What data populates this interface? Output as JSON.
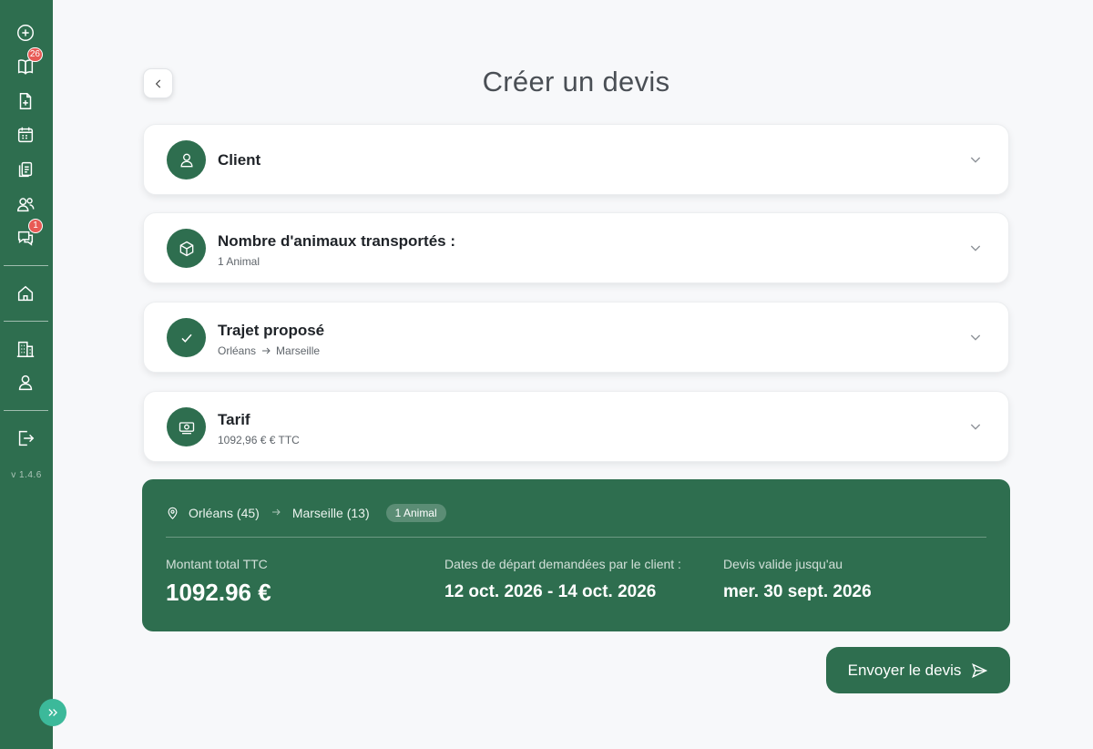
{
  "sidebar": {
    "icons": [
      {
        "name": "add-circle-icon"
      },
      {
        "name": "book-icon",
        "badge": "26"
      },
      {
        "name": "new-document-icon"
      },
      {
        "name": "calendar-icon"
      },
      {
        "name": "documents-icon"
      },
      {
        "name": "users-icon"
      },
      {
        "name": "chat-icon",
        "badge": "1"
      },
      {
        "name": "home-icon"
      },
      {
        "name": "building-icon"
      },
      {
        "name": "user-icon"
      },
      {
        "name": "logout-icon"
      }
    ],
    "version": "v 1.4.6",
    "expand_icon": "double-chevron-right-icon"
  },
  "header": {
    "title": "Créer un devis",
    "back_icon": "chevron-left-icon"
  },
  "sections": [
    {
      "icon": "user-icon",
      "title": "Client",
      "subtitle": ""
    },
    {
      "icon": "box-icon",
      "title": "Nombre d'animaux transportés :",
      "subtitle": "1 Animal"
    },
    {
      "icon": "check-icon",
      "title": "Trajet proposé",
      "subtitle_from": "Orléans",
      "subtitle_to": "Marseille"
    },
    {
      "icon": "money-icon",
      "title": "Tarif",
      "subtitle": "1092,96 € € TTC"
    }
  ],
  "summary": {
    "from": "Orléans (45)",
    "to": "Marseille (13)",
    "animals_badge": "1 Animal",
    "total_label": "Montant total TTC",
    "total_value": "1092.96 €",
    "dates_label": "Dates de départ demandées par le client :",
    "dates_value": "12 oct. 2026 - 14 oct. 2026",
    "valid_label": "Devis valide jusqu'au",
    "valid_value": "mer. 30 sept. 2026"
  },
  "actions": {
    "send_label": "Envoyer le devis"
  },
  "colors": {
    "primary": "#2e6e4f",
    "badge": "#e85a55",
    "expand": "#3cb99a",
    "background": "#f7f8fa"
  }
}
